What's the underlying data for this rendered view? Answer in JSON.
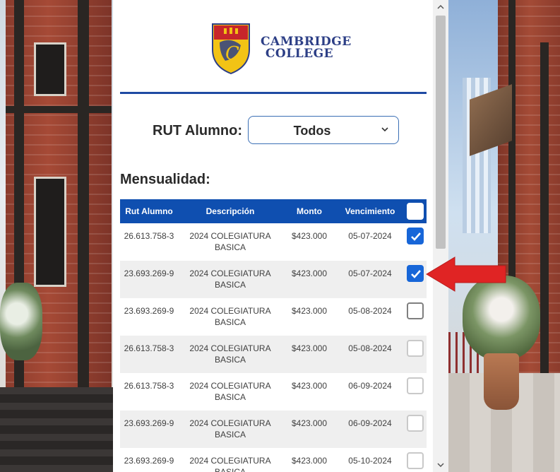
{
  "brand": {
    "line1": "CAMBRIDGE",
    "line2": "COLLEGE",
    "colors": {
      "blue": "#2d3f86",
      "red": "#c7252b",
      "yellow": "#f2c315"
    }
  },
  "filter": {
    "label": "RUT Alumno:",
    "selected": "Todos"
  },
  "section_title": "Mensualidad:",
  "table": {
    "headers": [
      "Rut Alumno",
      "Descripción",
      "Monto",
      "Vencimiento"
    ],
    "rows": [
      {
        "rut": "26.613.758-3",
        "desc1": "2024 COLEGIATURA",
        "desc2": "BASICA",
        "monto": "$423.000",
        "venc": "05-07-2024",
        "checked": true
      },
      {
        "rut": "23.693.269-9",
        "desc1": "2024 COLEGIATURA",
        "desc2": "BASICA",
        "monto": "$423.000",
        "venc": "05-07-2024",
        "checked": true
      },
      {
        "rut": "23.693.269-9",
        "desc1": "2024 COLEGIATURA",
        "desc2": "BASICA",
        "monto": "$423.000",
        "venc": "05-08-2024",
        "checked": false
      },
      {
        "rut": "26.613.758-3",
        "desc1": "2024 COLEGIATURA",
        "desc2": "BASICA",
        "monto": "$423.000",
        "venc": "05-08-2024",
        "checked": false
      },
      {
        "rut": "26.613.758-3",
        "desc1": "2024 COLEGIATURA",
        "desc2": "BASICA",
        "monto": "$423.000",
        "venc": "06-09-2024",
        "checked": false
      },
      {
        "rut": "23.693.269-9",
        "desc1": "2024 COLEGIATURA",
        "desc2": "BASICA",
        "monto": "$423.000",
        "venc": "06-09-2024",
        "checked": false
      },
      {
        "rut": "23.693.269-9",
        "desc1": "2024 COLEGIATURA",
        "desc2": "BASICA",
        "monto": "$423.000",
        "venc": "05-10-2024",
        "checked": false
      }
    ]
  },
  "colors": {
    "header_bg": "#0f4fb0",
    "divider": "#1f4aa3",
    "checkbox_checked": "#1766d8",
    "arrow": "#e02424"
  },
  "icons": {
    "dropdown": "chevron-down-icon",
    "checked": "check-icon",
    "annotation": "red-arrow-icon"
  }
}
